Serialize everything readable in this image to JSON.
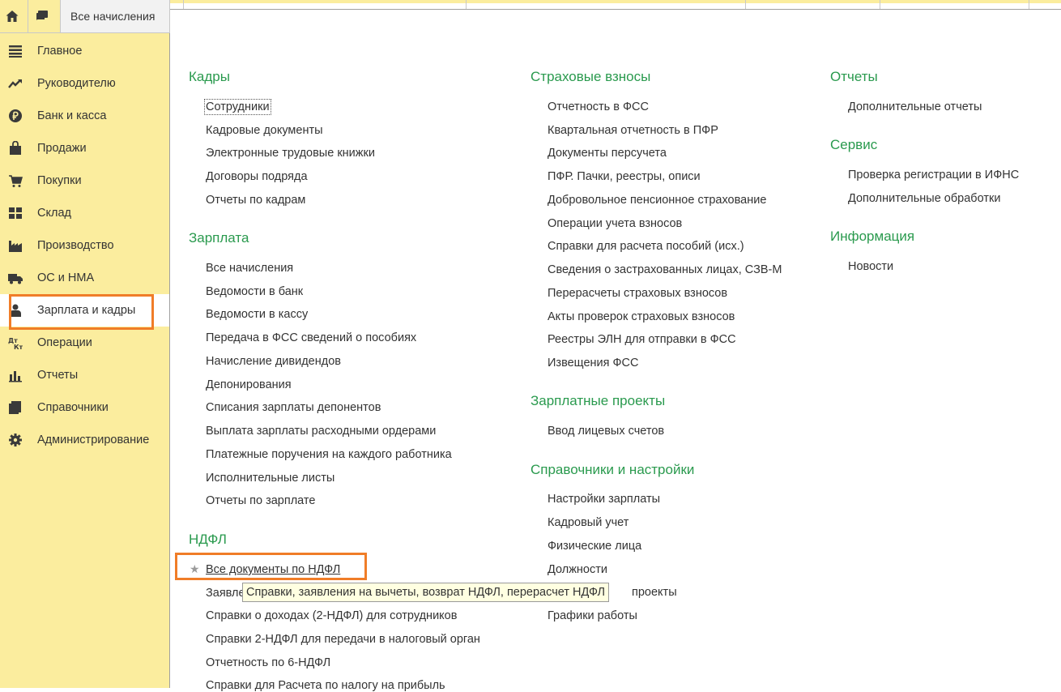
{
  "topbar": {
    "tab_label": "Все начисления",
    "icons": [
      "home-icon",
      "chat-icon"
    ]
  },
  "sidebar": {
    "items": [
      {
        "label": "Главное",
        "icon": "menu-lines-icon"
      },
      {
        "label": "Руководителю",
        "icon": "trend-up-icon"
      },
      {
        "label": "Банк и касса",
        "icon": "ruble-coin-icon"
      },
      {
        "label": "Продажи",
        "icon": "shopping-bag-icon"
      },
      {
        "label": "Покупки",
        "icon": "cart-icon"
      },
      {
        "label": "Склад",
        "icon": "warehouse-grid-icon"
      },
      {
        "label": "Производство",
        "icon": "factory-icon"
      },
      {
        "label": "ОС и НМА",
        "icon": "truck-icon"
      },
      {
        "label": "Зарплата и кадры",
        "icon": "person-icon"
      },
      {
        "label": "Операции",
        "icon": "debit-credit-icon"
      },
      {
        "label": "Отчеты",
        "icon": "bar-chart-icon"
      },
      {
        "label": "Справочники",
        "icon": "books-icon"
      },
      {
        "label": "Администрирование",
        "icon": "gear-icon"
      }
    ],
    "active_index": 8
  },
  "sections": {
    "kadry": {
      "title": "Кадры",
      "links": [
        "Сотрудники",
        "Кадровые документы",
        "Электронные трудовые книжки",
        "Договоры подряда",
        "Отчеты по кадрам"
      ]
    },
    "zarplata": {
      "title": "Зарплата",
      "links": [
        "Все начисления",
        "Ведомости в банк",
        "Ведомости в кассу",
        "Передача в ФСС сведений о пособиях",
        "Начисление дивидендов",
        "Депонирования",
        "Списания зарплаты депонентов",
        "Выплата зарплаты расходными ордерами",
        "Платежные поручения на каждого работника",
        "Исполнительные листы",
        "Отчеты по зарплате"
      ]
    },
    "ndfl": {
      "title": "НДФЛ",
      "links": [
        "Все документы по НДФЛ",
        "Заявле",
        "Справки о доходах (2-НДФЛ) для сотрудников",
        "Справки 2-НДФЛ для передачи в налоговый орган",
        "Отчетность по 6-НДФЛ",
        "Справки для Расчета по налогу на прибыль"
      ]
    },
    "vznosy": {
      "title": "Страховые взносы",
      "links": [
        "Отчетность в ФСС",
        "Квартальная отчетность в ПФР",
        "Документы персучета",
        "ПФР. Пачки, реестры, описи",
        "Добровольное пенсионное страхование",
        "Операции учета взносов",
        "Справки для расчета пособий (исх.)",
        "Сведения о застрахованных лицах, СЗВ-М",
        "Перерасчеты страховых взносов",
        "Акты проверок страховых взносов",
        "Реестры ЭЛН для отправки в ФСС",
        "Извещения ФСС"
      ]
    },
    "proekty": {
      "title": "Зарплатные проекты",
      "links": [
        "Ввод лицевых счетов"
      ]
    },
    "spravochniki": {
      "title": "Справочники и настройки",
      "links": [
        "Настройки зарплаты",
        "Кадровый учет",
        "Физические лица",
        "Должности",
        "проекты",
        "Графики работы"
      ]
    },
    "otchety": {
      "title": "Отчеты",
      "links": [
        "Дополнительные отчеты"
      ]
    },
    "servis": {
      "title": "Сервис",
      "links": [
        "Проверка регистрации в ИФНС",
        "Дополнительные обработки"
      ]
    },
    "info": {
      "title": "Информация",
      "links": [
        "Новости"
      ]
    }
  },
  "tooltip": "Справки, заявления на вычеты, возврат НДФЛ, перерасчет НДФЛ",
  "colors": {
    "sidebar_bg": "#fbed9e",
    "section_title": "#2a9a4e",
    "highlight": "#f07d28",
    "tooltip_bg": "#ffffe1"
  }
}
